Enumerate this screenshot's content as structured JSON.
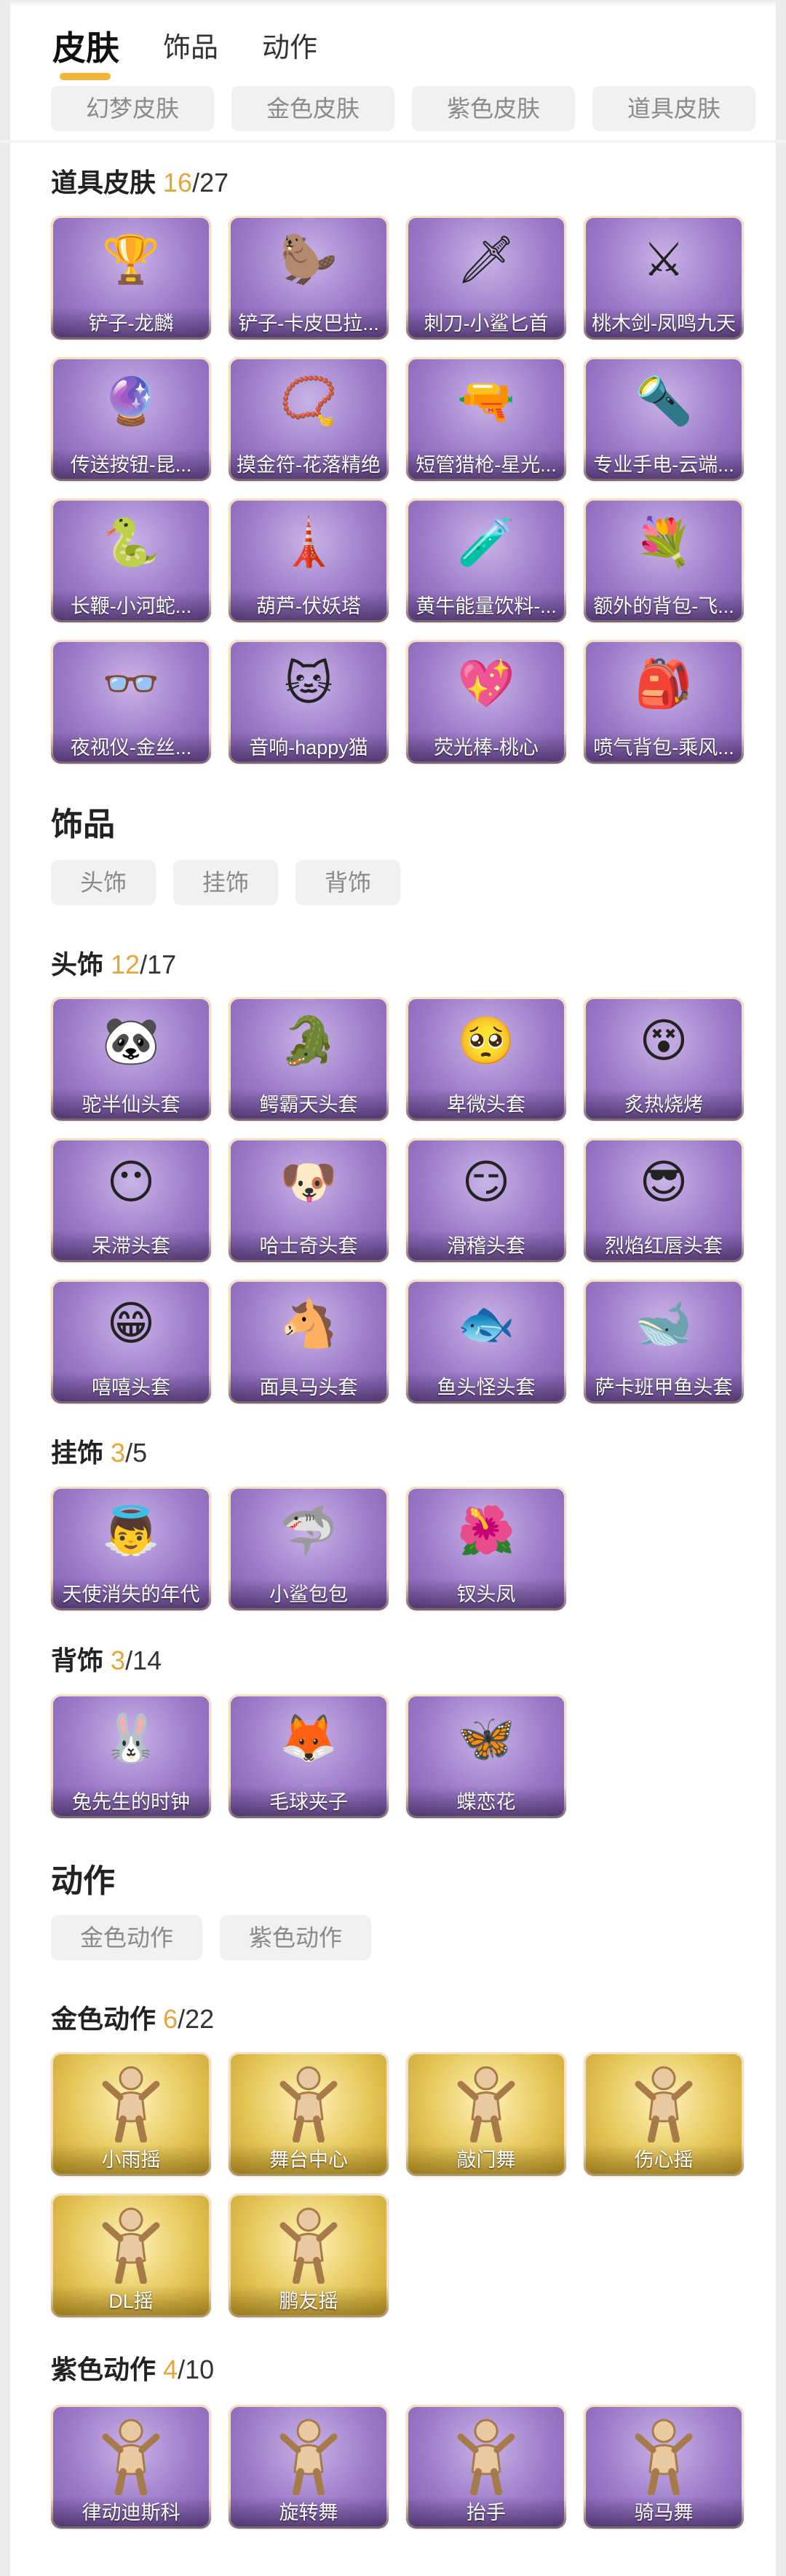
{
  "tabs": [
    "皮肤",
    "饰品",
    "动作"
  ],
  "skin_chips": [
    "幻梦皮肤",
    "金色皮肤",
    "紫色皮肤",
    "道具皮肤"
  ],
  "prop_skins": {
    "title": "道具皮肤",
    "owned": "16",
    "slash": "/",
    "total": "27",
    "items": [
      {
        "label": "铲子-龙麟",
        "icon": "golden-shovel-icon",
        "glyph": "🏆"
      },
      {
        "label": "铲子-卡皮巴拉...",
        "icon": "capybara-shovel-icon",
        "glyph": "🦫"
      },
      {
        "label": "刺刀-小鲨匕首",
        "icon": "shark-dagger-icon",
        "glyph": "🗡"
      },
      {
        "label": "桃木剑-凤鸣九天",
        "icon": "peach-sword-icon",
        "glyph": "⚔"
      },
      {
        "label": "传送按钮-昆...",
        "icon": "teleport-button-icon",
        "glyph": "🔮"
      },
      {
        "label": "摸金符-花落精绝",
        "icon": "amulet-icon",
        "glyph": "📿"
      },
      {
        "label": "短管猎枪-星光...",
        "icon": "shotgun-icon",
        "glyph": "🔫"
      },
      {
        "label": "专业手电-云端...",
        "icon": "flashlight-icon",
        "glyph": "🔦"
      },
      {
        "label": "长鞭-小河蛇...",
        "icon": "whip-snake-icon",
        "glyph": "🐍"
      },
      {
        "label": "葫芦-伏妖塔",
        "icon": "gourd-tower-icon",
        "glyph": "🗼"
      },
      {
        "label": "黄牛能量饮料-...",
        "icon": "energy-drink-icon",
        "glyph": "🧪"
      },
      {
        "label": "额外的背包-飞...",
        "icon": "flower-backpack-icon",
        "glyph": "💐"
      },
      {
        "label": "夜视仪-金丝...",
        "icon": "night-vision-glasses-icon",
        "glyph": "👓"
      },
      {
        "label": "音响-happy猫",
        "icon": "happy-cat-speaker-icon",
        "glyph": "🐱"
      },
      {
        "label": "荧光棒-桃心",
        "icon": "heart-glowstick-icon",
        "glyph": "💖"
      },
      {
        "label": "喷气背包-乘风...",
        "icon": "jetpack-icon",
        "glyph": "🎒"
      }
    ]
  },
  "accessories": {
    "title": "饰品",
    "chips": [
      "头饰",
      "挂饰",
      "背饰"
    ],
    "head": {
      "title": "头饰",
      "owned": "12",
      "slash": "/",
      "total": "17",
      "items": [
        {
          "label": "驼半仙头套",
          "icon": "panda-mask-icon",
          "glyph": "🐼"
        },
        {
          "label": "鳄霸天头套",
          "icon": "crocodile-mask-icon",
          "glyph": "🐊"
        },
        {
          "label": "卑微头套",
          "icon": "humble-emoji-mask-icon",
          "glyph": "🥺"
        },
        {
          "label": "炙热烧烤",
          "icon": "bbq-mask-icon",
          "glyph": "😵"
        },
        {
          "label": "呆滞头套",
          "icon": "dazed-emoji-mask-icon",
          "glyph": "😶"
        },
        {
          "label": "哈士奇头套",
          "icon": "husky-mask-icon",
          "glyph": "🐶"
        },
        {
          "label": "滑稽头套",
          "icon": "funny-emoji-mask-icon",
          "glyph": "😏"
        },
        {
          "label": "烈焰红唇头套",
          "icon": "pikachu-mask-icon",
          "glyph": "😎"
        },
        {
          "label": "嘻嘻头套",
          "icon": "grin-emoji-mask-icon",
          "glyph": "😁"
        },
        {
          "label": "面具马头套",
          "icon": "horse-mask-icon",
          "glyph": "🐴"
        },
        {
          "label": "鱼头怪头套",
          "icon": "fish-head-mask-icon",
          "glyph": "🐟"
        },
        {
          "label": "萨卡班甲鱼头套",
          "icon": "sacabambaspis-mask-icon",
          "glyph": "🐋"
        }
      ]
    },
    "hanging": {
      "title": "挂饰",
      "owned": "3",
      "slash": "/",
      "total": "5",
      "items": [
        {
          "label": "天使消失的年代",
          "icon": "angel-doll-icon",
          "glyph": "👼"
        },
        {
          "label": "小鲨包包",
          "icon": "shark-bag-icon",
          "glyph": "🦈"
        },
        {
          "label": "钗头凤",
          "icon": "phoenix-hairpin-icon",
          "glyph": "🌺"
        }
      ]
    },
    "back": {
      "title": "背饰",
      "owned": "3",
      "slash": "/",
      "total": "14",
      "items": [
        {
          "label": "兔先生的时钟",
          "icon": "rabbit-clock-icon",
          "glyph": "🐰"
        },
        {
          "label": "毛球夹子",
          "icon": "furball-clip-icon",
          "glyph": "🦊"
        },
        {
          "label": "蝶恋花",
          "icon": "butterfly-flower-icon",
          "glyph": "🦋"
        }
      ]
    }
  },
  "actions": {
    "title": "动作",
    "chips": [
      "金色动作",
      "紫色动作"
    ],
    "gold": {
      "title": "金色动作",
      "owned": "6",
      "slash": "/",
      "total": "22",
      "items": [
        {
          "label": "小雨摇",
          "icon": "dance-figure-icon"
        },
        {
          "label": "舞台中心",
          "icon": "dance-figure-icon"
        },
        {
          "label": "敲门舞",
          "icon": "dance-figure-icon"
        },
        {
          "label": "伤心摇",
          "icon": "dance-figure-icon"
        },
        {
          "label": "DL摇",
          "icon": "dance-figure-icon"
        },
        {
          "label": "鹏友摇",
          "icon": "dance-figure-icon"
        }
      ]
    },
    "purple": {
      "title": "紫色动作",
      "owned": "4",
      "slash": "/",
      "total": "10",
      "items": [
        {
          "label": "律动迪斯科",
          "icon": "dance-figure-icon"
        },
        {
          "label": "旋转舞",
          "icon": "dance-figure-icon"
        },
        {
          "label": "抬手",
          "icon": "dance-figure-icon"
        },
        {
          "label": "骑马舞",
          "icon": "dance-figure-icon"
        }
      ]
    }
  },
  "colors": {
    "accent": "#f2b43a",
    "count": "#e2a73b",
    "card_purple": "#9c7bc9",
    "card_gold": "#e6c75a"
  }
}
